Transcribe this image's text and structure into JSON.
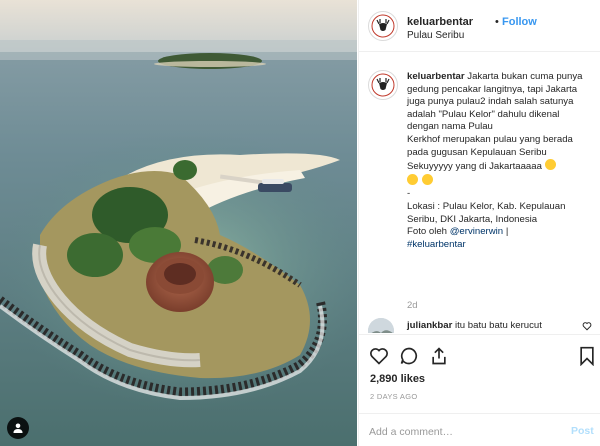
{
  "post": {
    "username": "keluarbentar",
    "follow_separator": "•",
    "follow_label": "Follow",
    "location": "Pulau Seribu"
  },
  "caption": {
    "username": "keluarbentar",
    "line1": "Jakarta bukan cuma punya gedung pencakar langitnya, tapi Jakarta juga punya pulau2 indah salah satunya adalah \"Pulau Kelor\" dahulu dikenal dengan nama Pulau",
    "line2": "Kerkhof merupakan pulau yang berada pada gugusan Kepulauan Seribu",
    "line3": "Sekuyyyyy yang di Jakartaaaaa",
    "dash": "-",
    "line4": "Lokasi : Pulau Kelor, Kab. Kepulauan Seribu, DKI Jakarta, Indonesia",
    "photo_by": "Foto oleh",
    "mention": "@ervinerwin",
    "pipe": "|",
    "hashtag": "#keluarbentar",
    "time": "2d"
  },
  "comments": [
    {
      "username": "juliankbar",
      "text": "itu batu batu kerucut"
    }
  ],
  "stats": {
    "likes": "2,890 likes",
    "posted_ago": "2 DAYS AGO"
  },
  "add_comment": {
    "placeholder": "Add a comment…",
    "post_label": "Post"
  },
  "icons": {
    "avatar": "deer-logo-icon",
    "like": "heart-icon",
    "comment": "speech-bubble-icon",
    "share": "share-icon",
    "save": "bookmark-icon",
    "comment_like": "small-heart-icon",
    "photo_user": "user-tag-icon"
  },
  "colors": {
    "link": "#3897f0",
    "mention": "#003569",
    "meta": "#999999",
    "border": "#efefef"
  }
}
